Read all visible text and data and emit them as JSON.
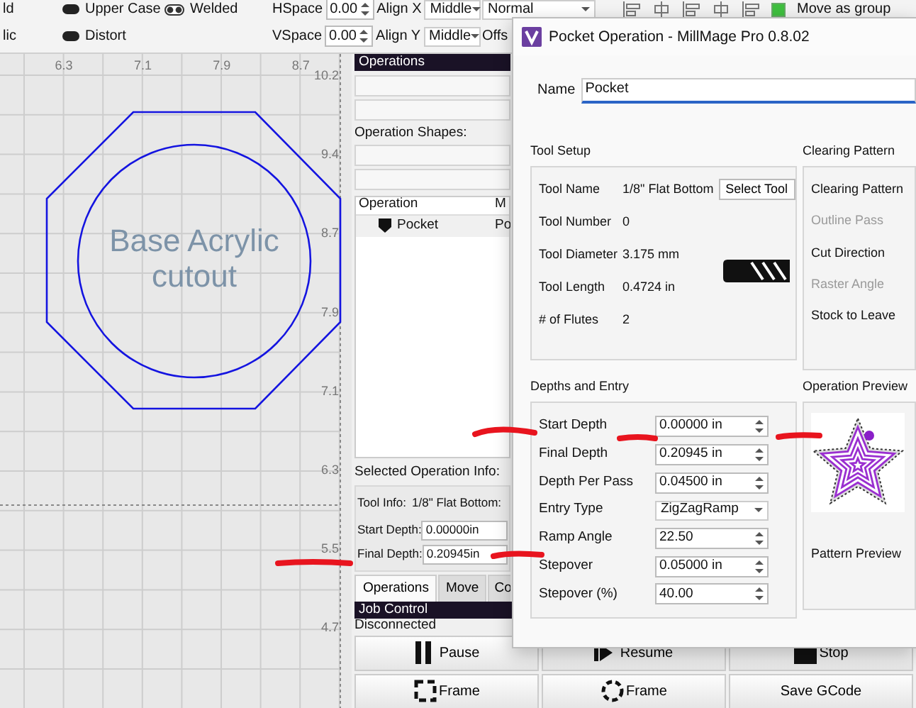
{
  "toolbar": {
    "style_labels": [
      "ld",
      "lic"
    ],
    "toggles": [
      {
        "label": "Upper Case",
        "kind": "pill"
      },
      {
        "label": "Welded",
        "kind": "link"
      },
      {
        "label": "Distort",
        "kind": "pill"
      }
    ],
    "spacing": [
      {
        "label": "HSpace",
        "value": "0.00",
        "align_label": "Align X",
        "align_value": "Middle"
      },
      {
        "label": "VSpace",
        "value": "0.00",
        "align_label": "Align Y",
        "align_value": "Middle"
      }
    ],
    "case_select": "Normal",
    "offset_label": "Offs",
    "move_as_group": {
      "label": "Move as group",
      "checked": true
    }
  },
  "canvas": {
    "x_ticks": [
      "6.3",
      "7.1",
      "7.9",
      "8.7"
    ],
    "y_ticks": [
      "10.2",
      "9.4",
      "8.7",
      "7.9",
      "7.1",
      "6.3",
      "5.5",
      "4.7"
    ],
    "label_lines": [
      "Base Acrylic",
      "cutout"
    ]
  },
  "operations_panel": {
    "title": "Operations",
    "shapes_label": "Operation Shapes:",
    "columns": [
      "Operation",
      "M"
    ],
    "rows": [
      {
        "name": "Pocket",
        "column_2": "Po"
      }
    ],
    "info_label": "Selected Operation Info:",
    "tool_info_label": "Tool Info:",
    "tool_info": "1/8\" Flat Bottom:",
    "fields": [
      {
        "label": "Start Depth:",
        "value": "0.00000in"
      },
      {
        "label": "Final Depth:",
        "value": "0.20945in"
      }
    ],
    "tabs": [
      {
        "label": "Operations",
        "selected": true
      },
      {
        "label": "Move",
        "selected": false
      },
      {
        "label": "Co",
        "selected": false
      }
    ]
  },
  "job_control": {
    "title": "Job Control",
    "status": "Disconnected",
    "buttons": [
      {
        "label": "Pause",
        "kind": "pause"
      },
      {
        "label": "Resume",
        "kind": "resume"
      },
      {
        "label": "Stop",
        "kind": "stop"
      },
      {
        "label": "Frame",
        "kind": "frame_rect"
      },
      {
        "label": "Frame",
        "kind": "frame_circle"
      },
      {
        "label": "Save GCode",
        "kind": "plain"
      }
    ]
  },
  "dialog": {
    "title": "Pocket Operation - MillMage Pro 0.8.02",
    "name_label": "Name",
    "name_value": "Pocket",
    "tool_setup": {
      "title": "Tool Setup",
      "button": "Select Tool",
      "rows": [
        {
          "label": "Tool Name",
          "value": "1/8\" Flat Bottom"
        },
        {
          "label": "Tool Number",
          "value": "0"
        },
        {
          "label": "Tool Diameter",
          "value": "3.175 mm"
        },
        {
          "label": "Tool Length",
          "value": "0.4724 in"
        },
        {
          "label": "# of Flutes",
          "value": "2"
        }
      ]
    },
    "clearing": {
      "title": "Clearing Pattern",
      "rows": [
        {
          "label": "Clearing Pattern",
          "disabled": false
        },
        {
          "label": "Outline Pass",
          "disabled": true
        },
        {
          "label": "Cut Direction",
          "disabled": false
        },
        {
          "label": "Raster Angle",
          "disabled": true
        },
        {
          "label": "Stock to Leave",
          "disabled": false
        }
      ]
    },
    "depths": {
      "title": "Depths and Entry",
      "rows": [
        {
          "label": "Start Depth",
          "value": "0.00000 in",
          "kind": "spin"
        },
        {
          "label": "Final Depth",
          "value": "0.20945 in",
          "kind": "spin"
        },
        {
          "label": "Depth Per Pass",
          "value": "0.04500 in",
          "kind": "spin"
        },
        {
          "label": "Entry Type",
          "value": "ZigZagRamp",
          "kind": "select"
        },
        {
          "label": "Ramp Angle",
          "value": "22.50",
          "kind": "spin"
        },
        {
          "label": "Stepover",
          "value": "0.05000 in",
          "kind": "spin"
        },
        {
          "label": "Stepover (%)",
          "value": "40.00",
          "kind": "spin"
        }
      ]
    },
    "preview": {
      "title": "Operation Preview",
      "button": "Pattern Preview"
    }
  }
}
